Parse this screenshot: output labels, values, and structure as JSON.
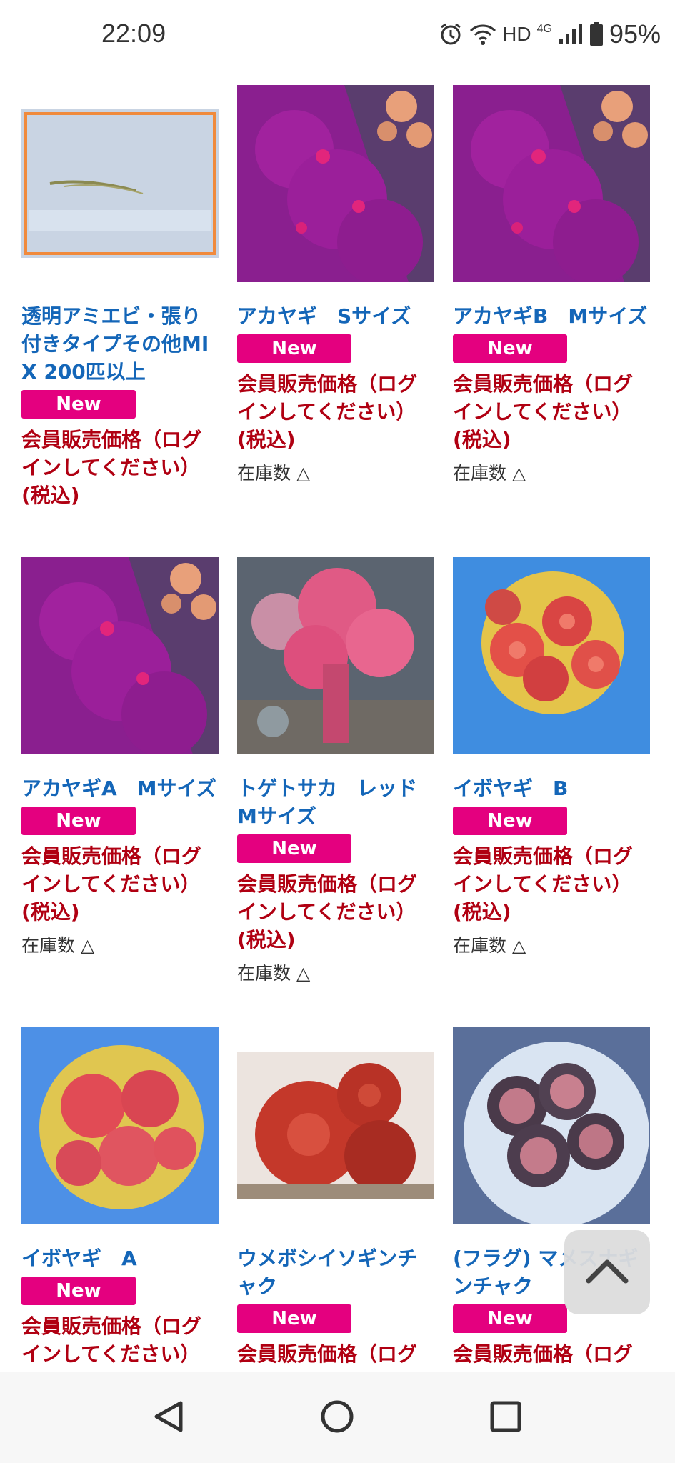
{
  "status_bar": {
    "time": "22:09",
    "network_label": "HD",
    "network_gen": "4G",
    "battery_percent": "95%",
    "icons": [
      "alarm-icon",
      "wifi-icon",
      "signal-icon",
      "battery-icon"
    ]
  },
  "colors": {
    "title_blue": "#1466b8",
    "badge_pink": "#e4007f",
    "price_red": "#b00012"
  },
  "products": [
    {
      "title": "透明アミエビ・張り付きタイプその他MIX 200匹以上",
      "badge": "New",
      "price": "会員販売価格（ログインしてください）(税込)",
      "stock": ""
    },
    {
      "title": "アカヤギ　Sサイズ",
      "badge": "New",
      "price": "会員販売価格（ログインしてください）(税込)",
      "stock": "在庫数 △"
    },
    {
      "title": "アカヤギB　Mサイズ",
      "badge": "New",
      "price": "会員販売価格（ログインしてください）(税込)",
      "stock": "在庫数 △"
    },
    {
      "title": "アカヤギA　Mサイズ",
      "badge": "New",
      "price": "会員販売価格（ログインしてください）(税込)",
      "stock": "在庫数 △"
    },
    {
      "title": "トゲトサカ　レッド Mサイズ",
      "badge": "New",
      "price": "会員販売価格（ログインしてください）(税込)",
      "stock": "在庫数 △"
    },
    {
      "title": "イボヤギ　B",
      "badge": "New",
      "price": "会員販売価格（ログインしてください）(税込)",
      "stock": "在庫数 △"
    },
    {
      "title": "イボヤギ　A",
      "badge": "New",
      "price": "会員販売価格（ログインしてください）",
      "stock": ""
    },
    {
      "title": "ウメボシイソギンチャク",
      "badge": "New",
      "price": "会員販売価格（ログ",
      "stock": ""
    },
    {
      "title": "(フラグ) マメスナギンチャク",
      "badge": "New",
      "price": "会員販売価格（ログ",
      "stock": ""
    }
  ],
  "nav": {
    "back": "back-icon",
    "home": "home-icon",
    "recents": "recents-icon"
  }
}
